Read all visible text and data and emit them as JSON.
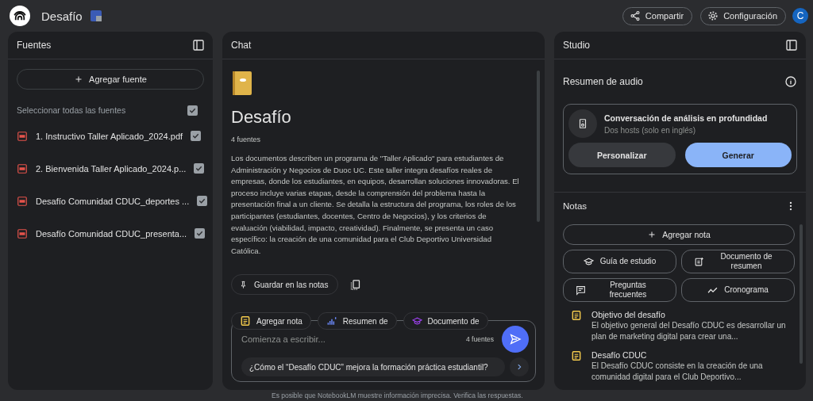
{
  "header": {
    "title": "Desafío",
    "actions": [
      {
        "label": "Compartir",
        "kind": "share"
      },
      {
        "label": "Configuración",
        "kind": "settings"
      }
    ],
    "avatar": "C"
  },
  "sources": {
    "title": "Fuentes",
    "add_button": "Agregar fuente",
    "select_all": {
      "label": "Seleccionar todas las fuentes",
      "checked": true
    },
    "items": [
      {
        "name": "1. Instructivo Taller Aplicado_2024.pdf",
        "checked": true
      },
      {
        "name": "2. Bienvenida Taller Aplicado_2024.p...",
        "checked": true
      },
      {
        "name": "Desafío Comunidad CDUC_deportes ...",
        "checked": true
      },
      {
        "name": "Desafío Comunidad CDUC_presenta...",
        "checked": true
      }
    ]
  },
  "chat": {
    "title": "Chat",
    "notebook_title": "Desafío",
    "source_count": "4 fuentes",
    "summary": "Los documentos describen un programa de \"Taller Aplicado\" para estudiantes de Administración y Negocios de Duoc UC. Este taller integra desafíos reales de empresas, donde los estudiantes, en equipos, desarrollan soluciones innovadoras. El proceso incluye varias etapas, desde la comprensión del problema hasta la presentación final a un cliente. Se detalla la estructura del programa, los roles de los participantes (estudiantes, docentes, Centro de Negocios), y los criterios de evaluación (viabilidad, impacto, creatividad). Finalmente, se presenta un caso específico: la creación de una comunidad para el Club Deportivo Universidad Católica.",
    "save_button": "Guardar en las notas",
    "chips": [
      {
        "label": "Agregar nota",
        "kind": "note"
      },
      {
        "label": "Resumen de",
        "kind": "audio"
      },
      {
        "label": "Documento de",
        "kind": "study"
      }
    ],
    "composer": {
      "placeholder": "Comienza a escribir...",
      "source_count": "4 fuentes",
      "suggestion": "¿Cómo el “Desafío CDUC” mejora la formación práctica estudiantil?"
    },
    "disclaimer": "Es posible que NotebookLM muestre información imprecisa. Verifica las respuestas."
  },
  "studio": {
    "title": "Studio",
    "audio": {
      "heading": "Resumen de audio",
      "card_title": "Conversación de análisis en profundidad",
      "card_subtitle": "Dos hosts (solo en inglés)",
      "buttons": [
        {
          "label": "Personalizar",
          "kind": "secondary"
        },
        {
          "label": "Generar",
          "kind": "primary"
        }
      ]
    },
    "notes": {
      "heading": "Notas",
      "add_button": "Agregar nota",
      "tools": [
        {
          "label": "Guía de estudio",
          "kind": "study"
        },
        {
          "label": "Documento de resumen",
          "kind": "doc"
        },
        {
          "label": "Preguntas frecuentes",
          "kind": "faq"
        },
        {
          "label": "Cronograma",
          "kind": "timeline"
        }
      ],
      "items": [
        {
          "title": "Objetivo del desafío",
          "text": "El objetivo general del Desafío CDUC es desarrollar un plan de marketing digital para crear una..."
        },
        {
          "title": "Desafío CDUC",
          "text": "El Desafío CDUC consiste en la creación de una comunidad digital para el Club Deportivo..."
        }
      ]
    }
  }
}
